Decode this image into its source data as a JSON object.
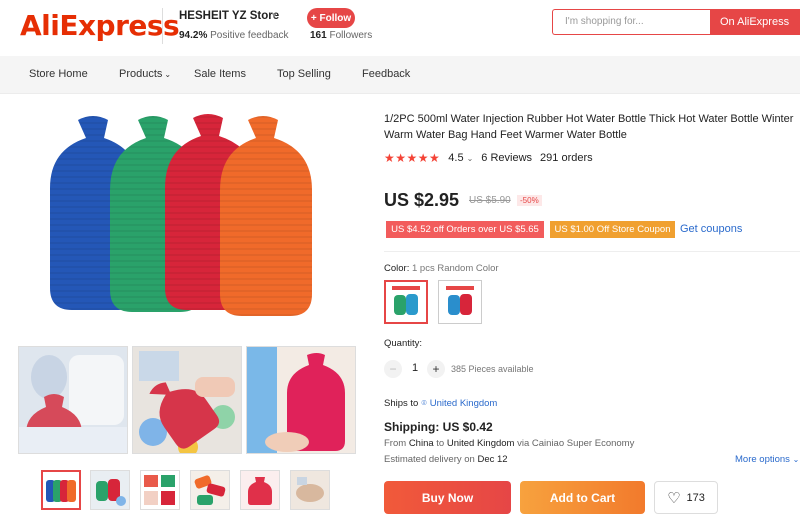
{
  "header": {
    "logo": "AliExpress",
    "store_name": "HESHEIT YZ Store",
    "feedback_pct": "94.2%",
    "feedback_label": "Positive feedback",
    "follow_label": "+ Follow",
    "followers_count": "161",
    "followers_label": "Followers",
    "search_placeholder": "I'm shopping for...",
    "search_button": "On AliExpress"
  },
  "nav": {
    "items": [
      "Store Home",
      "Products",
      "Sale Items",
      "Top Selling",
      "Feedback"
    ]
  },
  "product": {
    "title_line1": "1/2PC 500ml Water Injection Rubber Hot Water Bottle Thick Hot Water Bottle Winter",
    "title_line2": "Warm Water Bag Hand Feet Warmer Water Bottle",
    "rating": "4.5",
    "reviews": "6 Reviews",
    "orders": "291 orders",
    "price": "US $2.95",
    "old_price": "US $5.90",
    "discount": "-50%",
    "coupon_orders": "US $4.52 off Orders over US $5.65",
    "coupon_store": "US $1.00 Off Store Coupon",
    "get_coupons": "Get coupons",
    "color_label": "Color:",
    "color_value": "1 pcs Random Color",
    "quantity_label": "Quantity:",
    "quantity_value": "1",
    "pieces_available": "385 Pieces available",
    "ships_to_label": "Ships to",
    "ships_to_country": "United Kingdom",
    "shipping": "Shipping: US $0.42",
    "from_prefix": "From",
    "from_country": "China",
    "from_to": "to",
    "to_country": "United Kingdom",
    "via": "via Cainiao Super Economy",
    "delivery_prefix": "Estimated delivery on",
    "delivery_date": "Dec 12",
    "more_options": "More options",
    "buy_now": "Buy Now",
    "add_to_cart": "Add to Cart",
    "wishlist_count": "173"
  },
  "colors": {
    "brand": "#e62e04",
    "accent": "#e64646",
    "link": "#2a6acc",
    "coupon_orange": "#f0a030"
  }
}
